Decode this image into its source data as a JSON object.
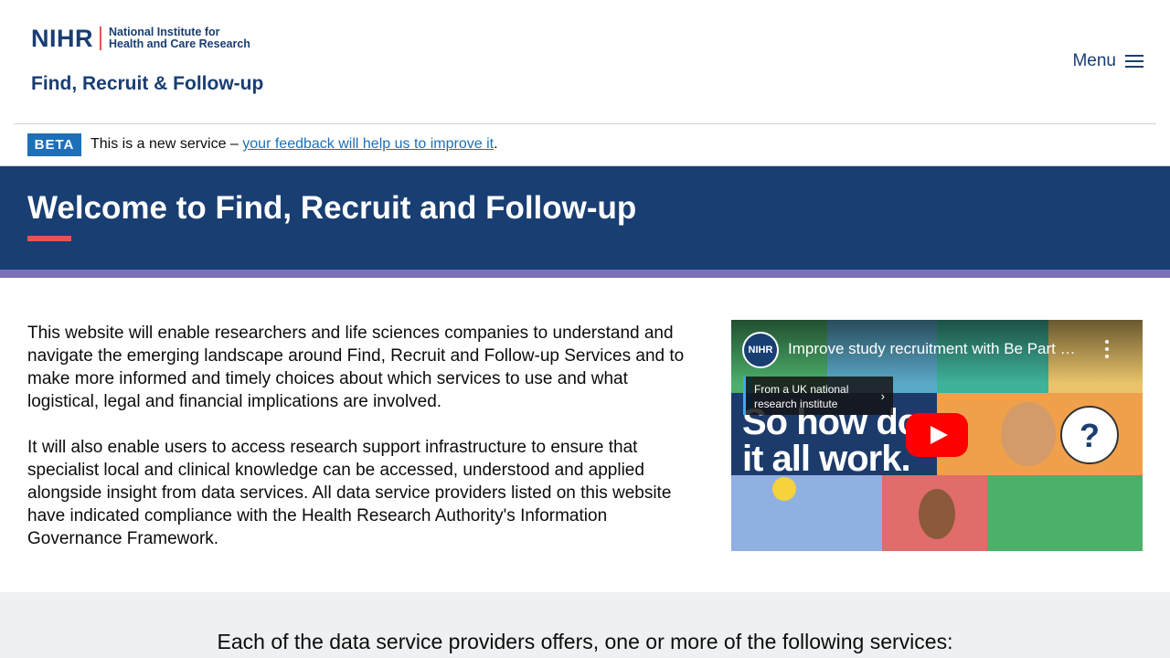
{
  "header": {
    "logo": {
      "abbr": "NIHR",
      "line1": "National Institute for",
      "line2": "Health and Care Research"
    },
    "site_title": "Find, Recruit & Follow-up",
    "menu_label": "Menu"
  },
  "beta_banner": {
    "tag": "BETA",
    "text_before": "This is a new service – ",
    "link_text": "your feedback will help us to improve it",
    "text_after": "."
  },
  "hero": {
    "title": "Welcome to Find, Recruit and Follow-up"
  },
  "intro": {
    "paragraph1": "This website will enable researchers and life sciences companies to understand and navigate the emerging landscape around Find, Recruit and Follow-up Services and to make more informed and timely choices about which services to use and what logistical, legal and financial implications are involved.",
    "paragraph2": "It will also enable users to access research support infrastructure to ensure that specialist local and clinical knowledge can be accessed, understood and applied alongside insight from data services. All data service providers listed on this website have indicated compliance with the Health Research Authority's Information Governance Framework."
  },
  "video": {
    "channel_badge": "NIHR",
    "title": "Improve study recruitment with Be Part …",
    "info_panel": "From a UK national research institute",
    "overlay_text_line1": "So how does",
    "overlay_text_line2": "it all work.",
    "question_mark": "?"
  },
  "services": {
    "heading": "Each of the data service providers offers, one or more of the following services:"
  },
  "colors": {
    "brand_navy": "#193e72",
    "accent_red": "#e5554f",
    "stripe_purple": "#7b6fb8",
    "link_blue": "#1d70b8",
    "youtube_red": "#ff0000"
  }
}
